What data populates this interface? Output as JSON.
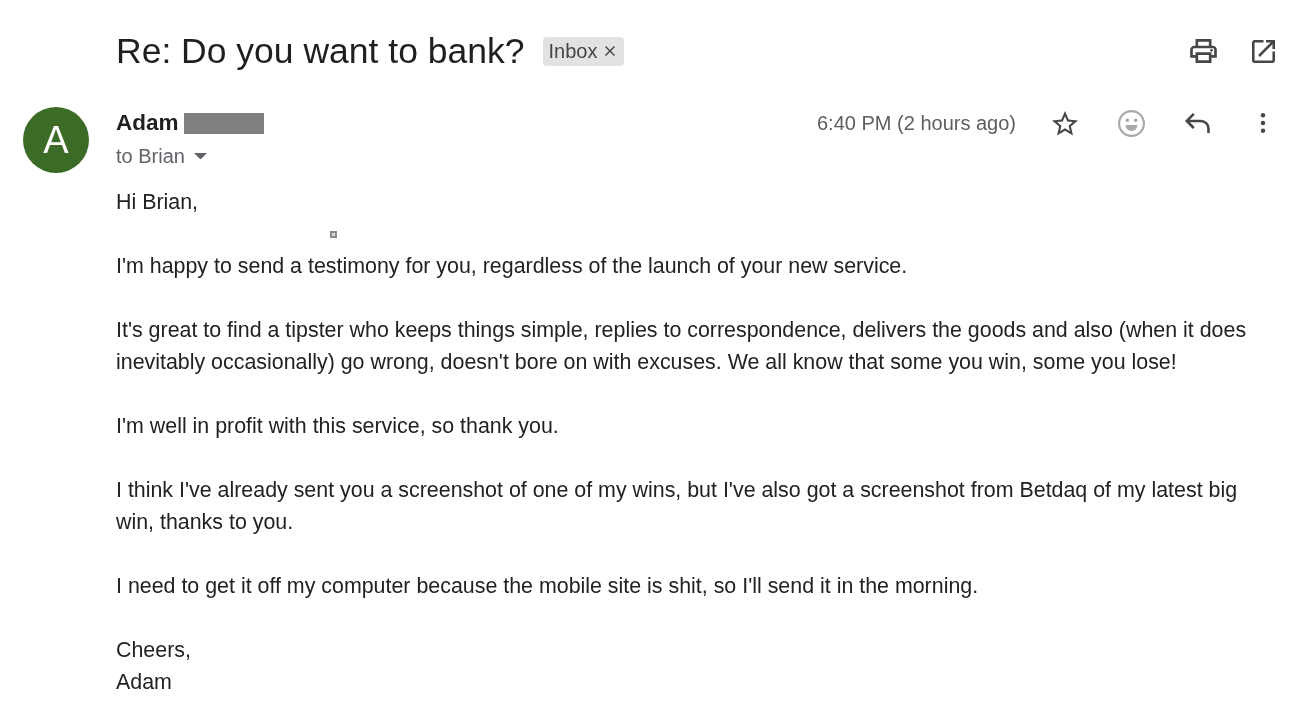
{
  "subject": {
    "title": "Re: Do you want to bank?",
    "labels": [
      {
        "text": "Inbox",
        "removable": true
      }
    ]
  },
  "message": {
    "avatar_initial": "A",
    "sender": {
      "name": "Adam",
      "surname_redacted": true
    },
    "recipients": "to Brian",
    "time": "6:40 PM (2 hours ago)",
    "starred": false,
    "body": [
      {
        "kind": "text",
        "text": "Hi Brian,"
      },
      {
        "kind": "image"
      },
      {
        "kind": "text",
        "text": "I'm happy to send a testimony for you, regardless of the launch of your new service."
      },
      {
        "kind": "text",
        "text": "It's great to find a tipster who keeps things simple, replies to correspondence, delivers the goods and also (when it does inevitably occasionally) go wrong, doesn't bore on with excuses. We all know that some you win, some you lose!"
      },
      {
        "kind": "text",
        "text": "I'm well in profit with this service, so thank you."
      },
      {
        "kind": "text",
        "text": "I think I've already sent you a screenshot of one of my wins, but I've also got a screenshot from Betdaq of my latest big win, thanks to you."
      },
      {
        "kind": "text",
        "text": "I need to get it off my computer because the mobile site is shit, so I'll send it in the morning."
      },
      {
        "kind": "closing",
        "lines": [
          "Cheers,",
          "Adam"
        ]
      }
    ]
  }
}
